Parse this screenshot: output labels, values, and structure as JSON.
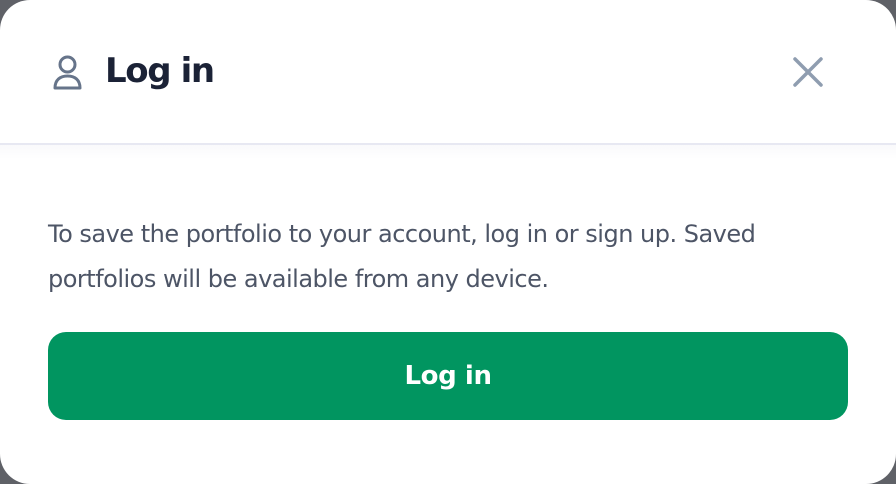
{
  "dialog": {
    "title": "Log in",
    "user_icon": "user-icon",
    "close_icon": "close-icon",
    "description": "To save the portfolio to your account, log in or sign up. Saved portfolios will be available from any device.",
    "login_button_label": "Log in"
  },
  "colors": {
    "accent": "#019560",
    "title_text": "#1b2236",
    "body_text": "#4d5566",
    "icon": "#66748a",
    "close_icon": "#8f9db0",
    "divider": "#e7e8f2"
  }
}
